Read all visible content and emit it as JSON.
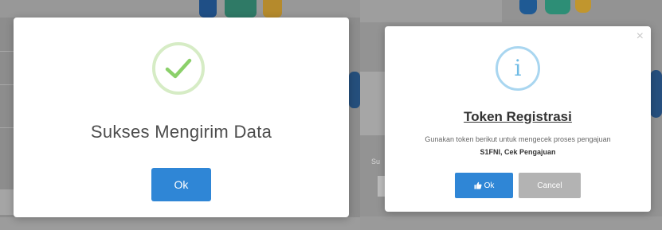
{
  "success_dialog": {
    "icon": "check-icon",
    "title": "Sukses Mengirim Data",
    "ok_label": "Ok",
    "accent": "#2f86d6",
    "icon_color": "#8bd06a"
  },
  "token_dialog": {
    "icon": "info-icon",
    "icon_glyph": "i",
    "close_glyph": "×",
    "title": "Token Registrasi",
    "message": "Gunakan token berikut untuk mengecek proses pengajuan",
    "token": "S1FNI",
    "separator": ", ",
    "check_link": "Cek Pengajuan",
    "ok_label": "Ok",
    "cancel_label": "Cancel",
    "accent": "#2f86d6"
  },
  "background": {
    "label_fragment": "Su"
  }
}
